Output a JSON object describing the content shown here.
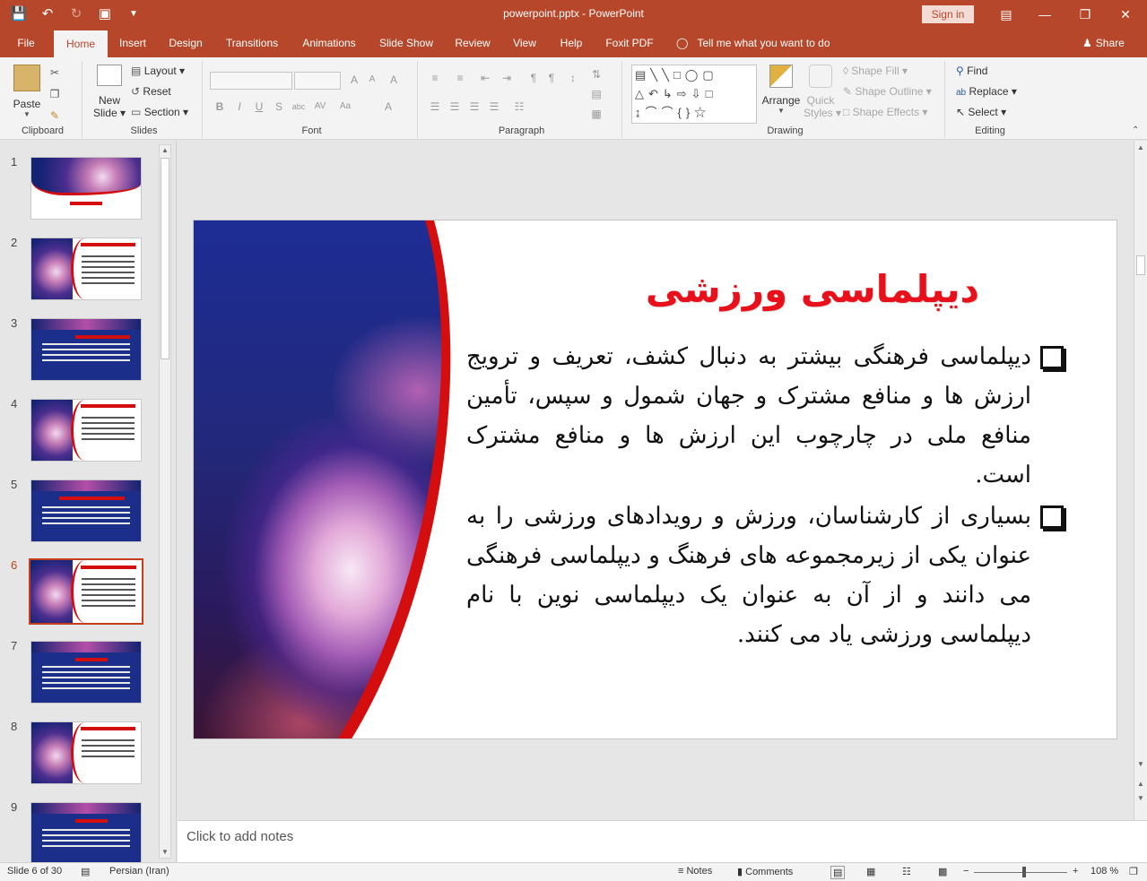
{
  "app": {
    "document_title": "powerpoint.pptx",
    "app_name": "PowerPoint",
    "title_separator": " - ",
    "sign_in": "Sign in"
  },
  "tabs": [
    "File",
    "Home",
    "Insert",
    "Design",
    "Transitions",
    "Animations",
    "Slide Show",
    "Review",
    "View",
    "Help",
    "Foxit PDF"
  ],
  "active_tab": "Home",
  "tell_me": "Tell me what you want to do",
  "share": "Share",
  "ribbon": {
    "clipboard": {
      "label": "Clipboard",
      "paste": "Paste"
    },
    "slides": {
      "label": "Slides",
      "new_slide_1": "New",
      "new_slide_2": "Slide",
      "layout": "Layout",
      "reset": "Reset",
      "section": "Section"
    },
    "font": {
      "label": "Font"
    },
    "paragraph": {
      "label": "Paragraph"
    },
    "drawing": {
      "label": "Drawing",
      "arrange": "Arrange",
      "quick_styles_1": "Quick",
      "quick_styles_2": "Styles",
      "shape_fill": "Shape Fill",
      "shape_outline": "Shape Outline",
      "shape_effects": "Shape Effects"
    },
    "editing": {
      "label": "Editing",
      "find": "Find",
      "replace": "Replace",
      "select": "Select"
    }
  },
  "thumbnails": [
    "1",
    "2",
    "3",
    "4",
    "5",
    "6",
    "7",
    "8",
    "9"
  ],
  "selected_slide": "6",
  "slide": {
    "title": "دیپلماسی ورزشی",
    "paragraphs": [
      "دیپلماسی فرهنگی بیشتر به دنبال کشف، تعریف و ترویج ارزش ها و منافع مشترک و جهان شمول و سپس، تأمین منافع ملی در چارچوب این ارزش ها و منافع مشترک است.",
      "بسیاری از کارشناسان، ورزش و رویدادهای ورزشی را به عنوان یکی از زیرمجموعه های فرهنگ و دیپلماسی فرهنگی می دانند و از آن به عنوان یک دیپلماسی نوین با نام دیپلماسی ورزشی یاد می کنند."
    ],
    "colors": {
      "title": "#e8101a",
      "accent_curve": "#d40e0e",
      "photo_blue": "#1d2d95"
    }
  },
  "notes_placeholder": "Click to add notes",
  "status": {
    "slide_info": "Slide 6 of 30",
    "language": "Persian (Iran)",
    "notes": "Notes",
    "comments": "Comments",
    "zoom": "108 %"
  },
  "icons": [
    "save-icon",
    "undo-icon",
    "redo-icon",
    "presenter-icon",
    "customize-qat-icon",
    "ribbon-display-icon",
    "minimize-icon",
    "restore-icon",
    "close-icon",
    "lightbulb-icon",
    "person-icon",
    "paste-icon",
    "cut-icon",
    "copy-icon",
    "format-painter-icon",
    "find-icon",
    "replace-icon",
    "select-icon",
    "notes-icon",
    "comments-icon",
    "normal-view-icon",
    "slide-sorter-icon",
    "reading-view-icon",
    "slideshow-icon"
  ],
  "accent": "#b7472a"
}
